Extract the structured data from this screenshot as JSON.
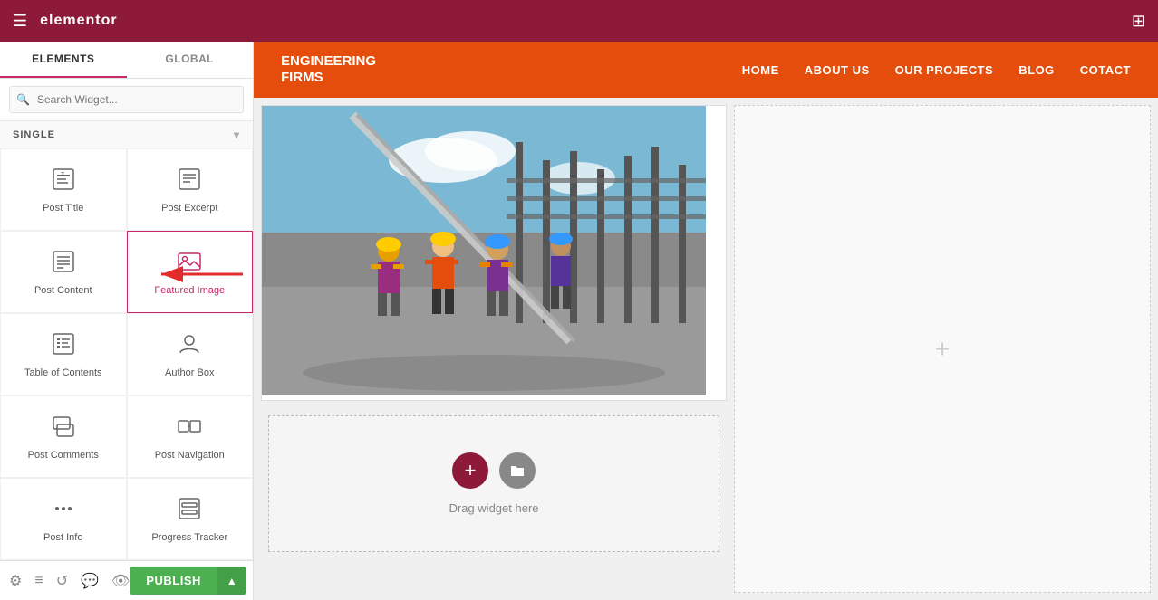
{
  "topbar": {
    "logo": "elementor",
    "hamburger": "☰",
    "grid": "⊞"
  },
  "sidebar": {
    "tabs": [
      {
        "id": "elements",
        "label": "ELEMENTS",
        "active": true
      },
      {
        "id": "global",
        "label": "GLOBAL",
        "active": false
      }
    ],
    "search": {
      "placeholder": "Search Widget..."
    },
    "section": {
      "label": "SINGLE",
      "arrow": "▾"
    },
    "widgets": [
      {
        "id": "post-title",
        "label": "Post Title",
        "icon": "📄",
        "highlighted": false,
        "row": 1,
        "col": 1
      },
      {
        "id": "post-excerpt",
        "label": "Post Excerpt",
        "icon": "📋",
        "highlighted": false,
        "row": 1,
        "col": 2
      },
      {
        "id": "post-content",
        "label": "Post Content",
        "icon": "📃",
        "highlighted": false,
        "row": 2,
        "col": 1
      },
      {
        "id": "featured-image",
        "label": "Featured Image",
        "icon": "🖼",
        "highlighted": true,
        "row": 2,
        "col": 2
      },
      {
        "id": "table-of-contents",
        "label": "Table of Contents",
        "icon": "📋",
        "highlighted": false,
        "row": 3,
        "col": 1
      },
      {
        "id": "author-box",
        "label": "Author Box",
        "icon": "👤",
        "highlighted": false,
        "row": 3,
        "col": 2
      },
      {
        "id": "post-comments",
        "label": "Post Comments",
        "icon": "💬",
        "highlighted": false,
        "row": 4,
        "col": 1
      },
      {
        "id": "post-navigation",
        "label": "Post Navigation",
        "icon": "⬌",
        "highlighted": false,
        "row": 4,
        "col": 2
      },
      {
        "id": "post-info",
        "label": "Post Info",
        "icon": "⋯",
        "highlighted": false,
        "row": 5,
        "col": 1
      },
      {
        "id": "progress-tracker",
        "label": "Progress Tracker",
        "icon": "⬛",
        "highlighted": false,
        "row": 5,
        "col": 2
      }
    ]
  },
  "toolbar": {
    "publish_label": "PUBLISH",
    "icons": [
      "⚙",
      "☰",
      "↺",
      "💬",
      "👁"
    ]
  },
  "navbar": {
    "logo_line1": "ENGINEERING",
    "logo_line2": "FIRMS",
    "links": [
      "HOME",
      "ABOUT US",
      "OUR PROJECTS",
      "BLOG",
      "COTACT"
    ]
  },
  "canvas": {
    "drag_label": "Drag widget here",
    "plus_label": "+",
    "folder_label": "📁"
  }
}
